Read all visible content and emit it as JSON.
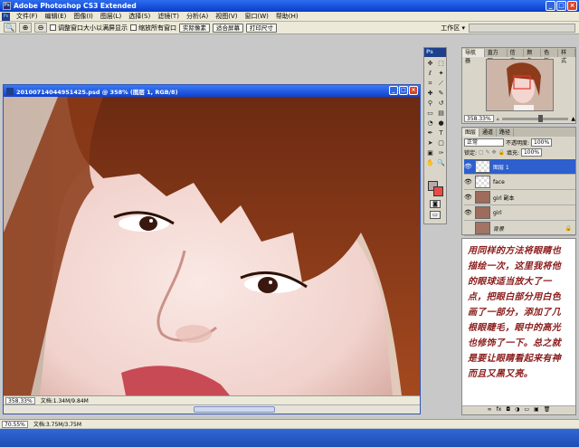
{
  "app": {
    "title": "Adobe Photoshop CS3 Extended"
  },
  "menu": [
    "文件(F)",
    "编辑(E)",
    "图像(I)",
    "图层(L)",
    "选择(S)",
    "滤镜(T)",
    "分析(A)",
    "视图(V)",
    "窗口(W)",
    "帮助(H)"
  ],
  "options": {
    "zoom_tool": "🔍",
    "check_resize": "调整窗口大小以满屏显示",
    "check_all": "缩放所有窗口",
    "btn_actual": "实际像素",
    "btn_fit": "适合屏幕",
    "btn_print": "打印尺寸",
    "workspace_label": "工作区 ▾"
  },
  "document": {
    "title": "20100714044951425.psd @ 358% (图层 1, RGB/8)",
    "zoom": "358.33%",
    "doc_size": "文档:1.34M/9.84M"
  },
  "app_status": {
    "zoom": "70.55%",
    "doc_size": "文档:3.75M/3.75M"
  },
  "toolbox": {
    "header": "Ps"
  },
  "navigator": {
    "tabs": [
      "导航器",
      "直方图",
      "信息",
      "颜色",
      "色板",
      "样式"
    ],
    "zoom": "358.33%"
  },
  "layers": {
    "tabs": [
      "图层",
      "通道",
      "路径"
    ],
    "blend_mode": "正常",
    "opacity_label": "不透明度:",
    "opacity": "100%",
    "lock_label": "锁定:",
    "fill_label": "填充:",
    "fill": "100%",
    "items": [
      {
        "name": "图层 1",
        "selected": true
      },
      {
        "name": "face",
        "selected": false
      },
      {
        "name": "girl 副本",
        "selected": false
      },
      {
        "name": "girl",
        "selected": false
      },
      {
        "name": "背景",
        "selected": false
      }
    ]
  },
  "note": {
    "text": "用同样的方法将眼睛也描绘一次，这里我将他的眼球适当放大了一点，把眼白部分用白色画了一部分，添加了几根眼睫毛，眼中的高光也修饰了一下。总之就是要让眼睛看起来有神而且又黑又亮。"
  },
  "colors": {
    "fg": "#b9a9aa",
    "bg": "#e94b4b",
    "accent": "#2d5fce"
  }
}
